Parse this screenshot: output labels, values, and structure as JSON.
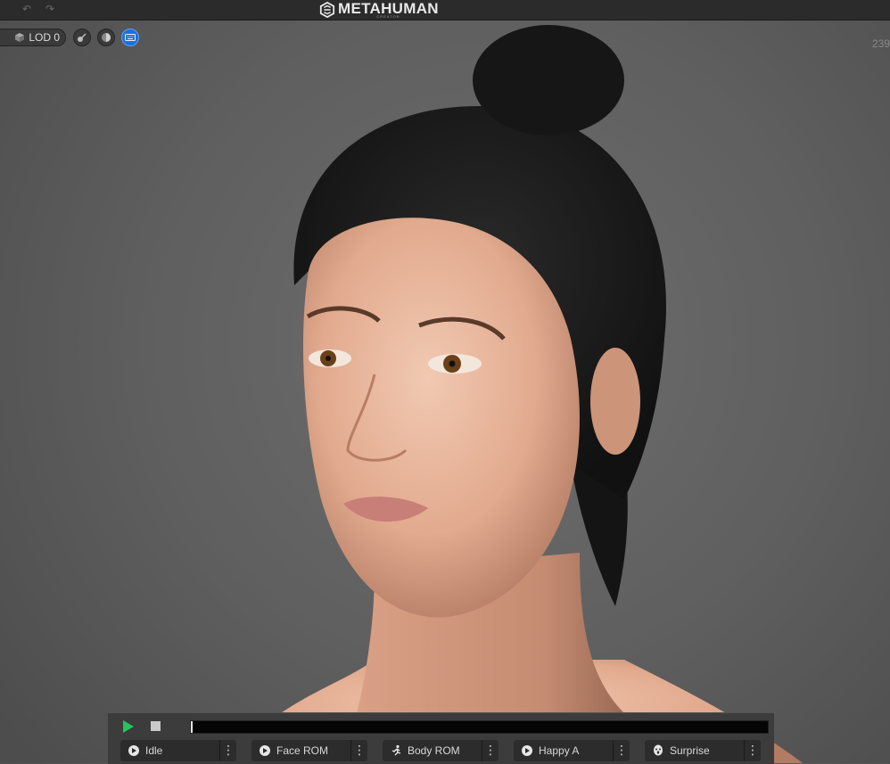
{
  "topbar": {
    "undo_icon": "undo-icon",
    "redo_icon": "redo-icon",
    "brand_title": "METAHUMAN",
    "brand_sub": "CREATOR"
  },
  "viewport": {
    "lod_label": "LOD 0",
    "corner_value": "239",
    "buttons": [
      {
        "icon": "lighting-icon"
      },
      {
        "icon": "render-mode-icon"
      },
      {
        "icon": "keyboard-icon",
        "active": true
      }
    ]
  },
  "animation": {
    "progress": 0.0,
    "play_icon": "play-icon",
    "stop_icon": "stop-icon",
    "presets": [
      {
        "label": "Idle",
        "icon": "idle-icon"
      },
      {
        "label": "Face ROM",
        "icon": "face-rom-icon"
      },
      {
        "label": "Body ROM",
        "icon": "running-figure-icon"
      },
      {
        "label": "Happy A",
        "icon": "happy-face-icon"
      },
      {
        "label": "Surprise",
        "icon": "surprise-face-icon"
      }
    ]
  },
  "colors": {
    "accent": "#1f6fd6",
    "play": "#22c55e",
    "viewport_bg": "#5f5f5f"
  }
}
